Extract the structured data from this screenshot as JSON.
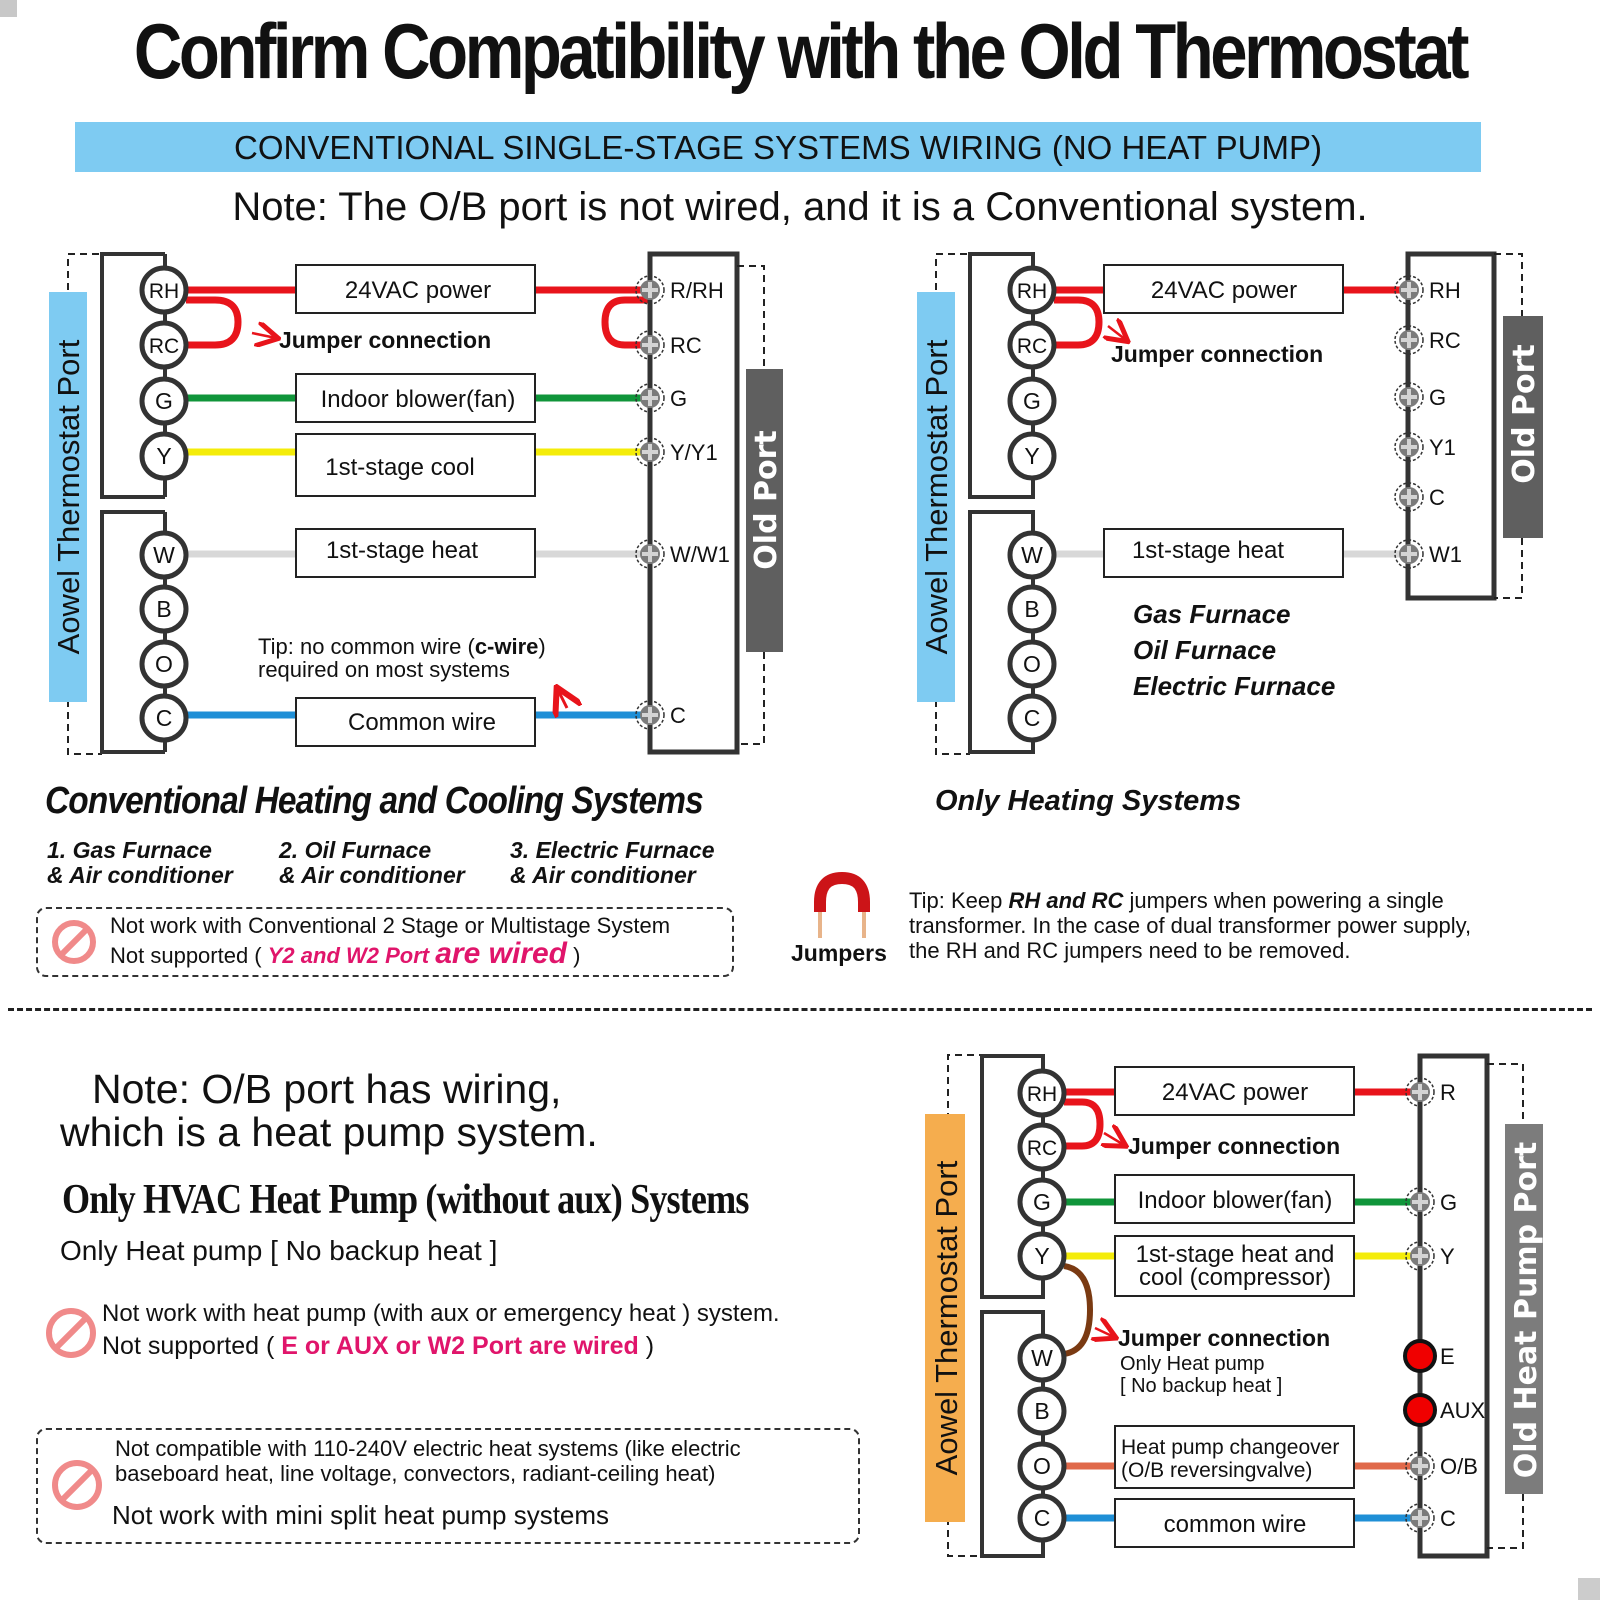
{
  "title": "Confirm Compatibility with the Old Thermostat",
  "banner": "CONVENTIONAL SINGLE-STAGE SYSTEMS WIRING (NO HEAT PUMP)",
  "note_conventional": "Note: The O/B port is not wired, and it is a Conventional system.",
  "colors": {
    "banner_blue": "#7ecbf2",
    "heat_pump_orange": "#f5ad4e",
    "old_port_gray": "#6a6a6a",
    "old_hp_port_gray": "#7c7c7c",
    "wire_red": "#e8141b",
    "wire_green": "#10953a",
    "wire_yellow": "#f4ec0a",
    "wire_white": "#d8d8d8",
    "wire_blue": "#1f8fd6",
    "wire_orange": "#e0694a",
    "wire_brown": "#7a3a12",
    "warning_pink": "#e0156b",
    "no_icon": "#f08a8a"
  },
  "diagram_conventional": {
    "side_label": "Aowel Thermostat Port",
    "old_port_label": "Old Port",
    "terminals": [
      "RH",
      "RC",
      "G",
      "Y",
      "W",
      "B",
      "O",
      "C"
    ],
    "boxes": [
      "24VAC power",
      "Indoor blower(fan)",
      "1st-stage cool",
      "1st-stage heat",
      "Common wire"
    ],
    "jumper_label": "Jumper connection",
    "old_terminals": [
      "R/RH",
      "RC",
      "G",
      "Y/Y1",
      "W/W1",
      "C"
    ],
    "tip_line1_pre": "Tip: no common wire (",
    "tip_line1_bold": "c-wire",
    "tip_line1_post": ")",
    "tip_line2": "required on most systems"
  },
  "diagram_heating": {
    "side_label": "Aowel Thermostat Port",
    "old_port_label": "Old Port",
    "terminals": [
      "RH",
      "RC",
      "G",
      "Y",
      "W",
      "B",
      "O",
      "C"
    ],
    "boxes": [
      "24VAC power",
      "1st-stage heat"
    ],
    "jumper_label": "Jumper connection",
    "old_terminals": [
      "RH",
      "RC",
      "G",
      "Y1",
      "C",
      "W1"
    ],
    "furnaces": [
      "Gas Furnace",
      "Oil Furnace",
      "Electric Furnace"
    ],
    "title": "Only Heating Systems"
  },
  "conventional_section": {
    "heading": "Conventional Heating and Cooling Systems",
    "systems": [
      {
        "line1": "1. Gas Furnace",
        "line2": "& Air conditioner"
      },
      {
        "line1": "2. Oil Furnace",
        "line2": "& Air conditioner"
      },
      {
        "line1": "3. Electric Furnace",
        "line2": "& Air conditioner"
      }
    ],
    "warning_line1": "Not work with Conventional 2 Stage or Multistage System",
    "warning_line2_pre": "Not supported ( ",
    "warning_line2_pink_small": "Y2 and W2 Port ",
    "warning_line2_pink_big": "are wired",
    "warning_line2_post": " )"
  },
  "jumpers_tip": {
    "icon_label": "Jumpers",
    "line1_pre": "Tip: Keep ",
    "line1_bold": "RH and RC",
    "line1_post": " jumpers when powering a single",
    "line2": "transformer. In the case of dual transformer power supply,",
    "line3": "the RH and RC jumpers need to be removed."
  },
  "heat_pump_section": {
    "note_line1": "Note: O/B port has wiring,",
    "note_line2": "which is a heat pump system.",
    "title": "Only HVAC Heat Pump (without aux) Systems",
    "subtitle": "Only Heat pump [ No backup heat ]",
    "warning1_line1": "Not work with heat pump (with aux or emergency heat ) system.",
    "warning1_line2_pre": "Not supported ( ",
    "warning1_line2_pink": "E or AUX or W2 Port are wired",
    "warning1_line2_post": " )",
    "warning2_line1": "Not compatible with 110-240V electric heat systems (like electric",
    "warning2_line2": "baseboard heat, line voltage, convectors, radiant-ceiling heat)",
    "warning2_line3": "Not work with mini split heat pump systems"
  },
  "diagram_heat_pump": {
    "side_label": "Aowel Thermostat Port",
    "old_port_label": "Old Heat Pump Port",
    "terminals": [
      "RH",
      "RC",
      "G",
      "Y",
      "W",
      "B",
      "O",
      "C"
    ],
    "box_power": "24VAC power",
    "box_fan": "Indoor blower(fan)",
    "box_y_line1": "1st-stage heat and",
    "box_y_line2": "cool (compressor)",
    "box_ob_line1": "Heat pump changeover",
    "box_ob_line2": "(O/B reversingvalve)",
    "box_common": "common wire",
    "jumper_label_top": "Jumper connection",
    "jumper_label_yw": "Jumper connection",
    "jumper_note_line1": "Only Heat pump",
    "jumper_note_line2": "[ No backup heat ]",
    "old_terminals": [
      "R",
      "G",
      "Y",
      "E",
      "AUX",
      "O/B",
      "C"
    ]
  }
}
